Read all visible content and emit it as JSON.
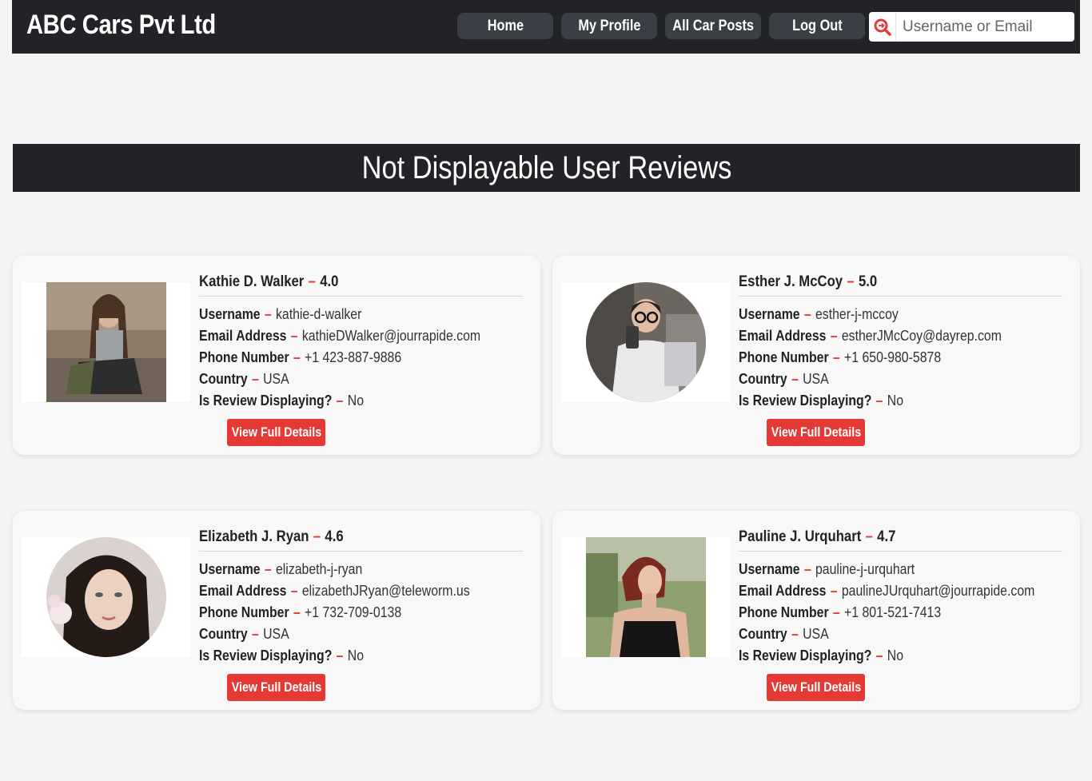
{
  "brand": "ABC Cars Pvt Ltd",
  "nav": {
    "home": "Home",
    "profile": "My Profile",
    "posts": "All Car Posts",
    "logout": "Log Out"
  },
  "search": {
    "placeholder": "Username or Email",
    "icon": "search-icon"
  },
  "section_title": "Not Displayable User Reviews",
  "labels": {
    "username": "Username",
    "email": "Email Address",
    "phone": "Phone Number",
    "country": "Country",
    "displaying": "Is Review Displaying?",
    "button": "View Full Details"
  },
  "colors": {
    "accent": "#e53935",
    "dark": "#212327"
  },
  "reviews": [
    {
      "name": "Kathie D. Walker",
      "rating": "4.0",
      "username": "kathie-d-walker",
      "email": "kathieDWalker@jourrapide.com",
      "phone": "+1 423-887-9886",
      "country": "USA",
      "displaying": "No"
    },
    {
      "name": "Esther J. McCoy",
      "rating": "5.0",
      "username": "esther-j-mccoy",
      "email": "estherJMcCoy@dayrep.com",
      "phone": "+1 650-980-5878",
      "country": "USA",
      "displaying": "No"
    },
    {
      "name": "Elizabeth J. Ryan",
      "rating": "4.6",
      "username": "elizabeth-j-ryan",
      "email": "elizabethJRyan@teleworm.us",
      "phone": "+1 732-709-0138",
      "country": "USA",
      "displaying": "No"
    },
    {
      "name": "Pauline J. Urquhart",
      "rating": "4.7",
      "username": "pauline-j-urquhart",
      "email": "paulineJUrquhart@jourrapide.com",
      "phone": "+1 801-521-7413",
      "country": "USA",
      "displaying": "No"
    }
  ]
}
